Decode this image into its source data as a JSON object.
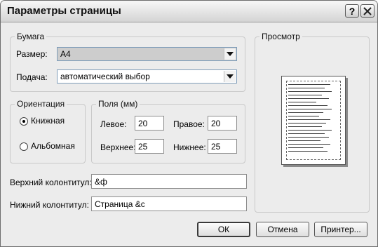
{
  "window": {
    "title": "Параметры страницы"
  },
  "titlebar": {
    "help_label": "?",
    "close_icon": "close-icon"
  },
  "paper": {
    "legend": "Бумага",
    "size_label": "Размер:",
    "size_value": "А4",
    "source_label": "Подача:",
    "source_value": "автоматический выбор"
  },
  "orientation": {
    "legend": "Ориентация",
    "portrait_label": "Книжная",
    "landscape_label": "Альбомная",
    "selected": "portrait"
  },
  "margins": {
    "legend": "Поля (мм)",
    "left_label": "Левое:",
    "left_value": "20",
    "right_label": "Правое:",
    "right_value": "20",
    "top_label": "Верхнее:",
    "top_value": "25",
    "bottom_label": "Нижнее:",
    "bottom_value": "25"
  },
  "header": {
    "label": "Верхний колонтитул:",
    "value": "&ф"
  },
  "footer": {
    "label": "Нижний колонтитул:",
    "value": "Страница &с"
  },
  "preview": {
    "legend": "Просмотр"
  },
  "buttons": {
    "ok": "ОК",
    "cancel": "Отмена",
    "printer": "Принтер..."
  }
}
